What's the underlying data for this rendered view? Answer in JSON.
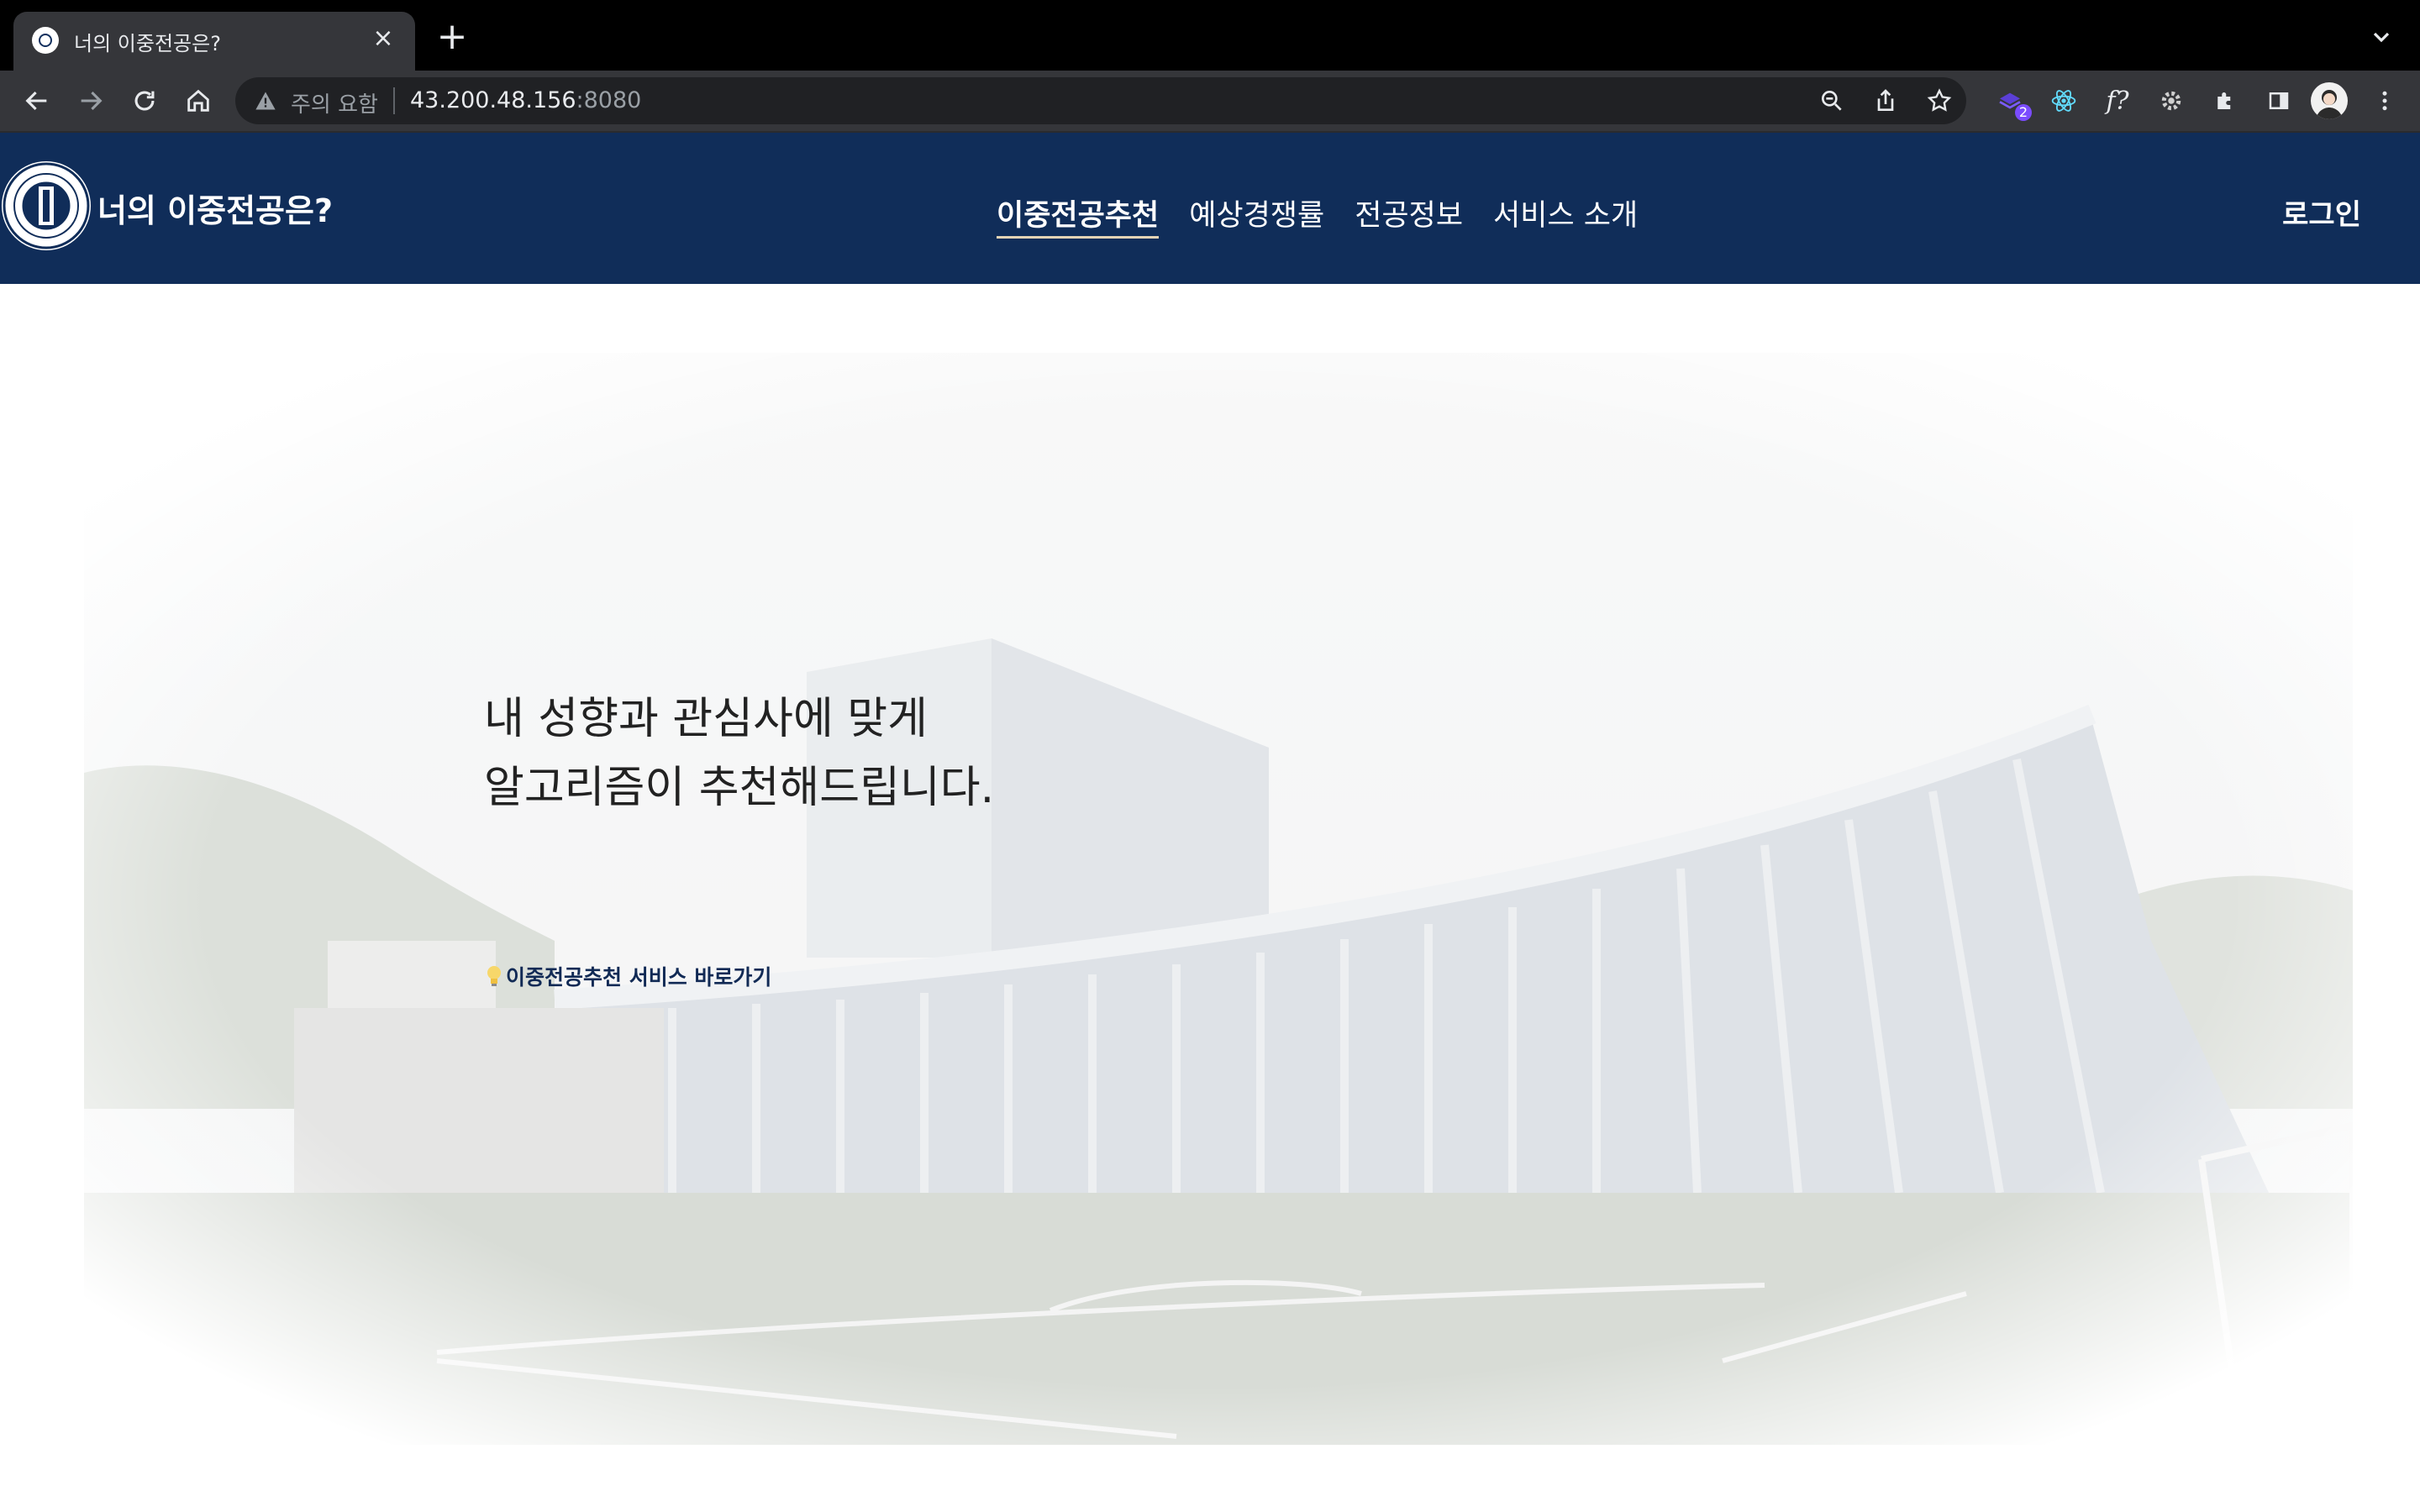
{
  "browser": {
    "tab": {
      "title": "너의 이중전공은?",
      "close_glyph": "×"
    },
    "new_tab_glyph": "+",
    "address_bar": {
      "security_label": "주의 요함",
      "url_host": "43.200.48.156",
      "url_port": ":8080"
    },
    "extensions": [
      {
        "icon": "purple-extension-icon",
        "badge": "2"
      },
      {
        "icon": "react-devtools-icon"
      },
      {
        "icon": "formula-icon",
        "glyph": "f?"
      },
      {
        "icon": "gear-extension-icon"
      },
      {
        "icon": "puzzle-icon"
      },
      {
        "icon": "side-panel-icon"
      },
      {
        "icon": "profile-avatar"
      },
      {
        "icon": "kebab-menu-icon"
      }
    ],
    "colors": {
      "tabstrip": "#000000",
      "toolbar": "#35363a",
      "omnibox": "#202124"
    }
  },
  "site": {
    "title": "너의 이중전공은?",
    "nav": [
      {
        "label": "이중전공추천",
        "active": true
      },
      {
        "label": "예상경쟁률",
        "active": false
      },
      {
        "label": "전공정보",
        "active": false
      },
      {
        "label": "서비스 소개",
        "active": false
      }
    ],
    "login_label": "로그인",
    "colors": {
      "header": "#102d59",
      "active_underline": "#e3d3b5"
    }
  },
  "hero": {
    "headline_line1": "내 성향과 관심사에 맞게",
    "headline_line2": "알고리즘이 추천해드립니다.",
    "cta_label": "이중전공추천 서비스 바로가기",
    "cta_icon": "lightbulb-icon"
  }
}
